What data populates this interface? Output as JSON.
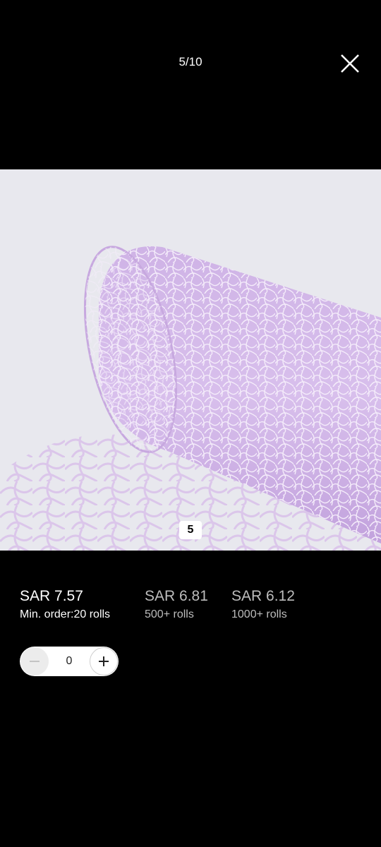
{
  "viewer": {
    "counter": "5/10",
    "close_icon": "close-icon",
    "image_badge": "5"
  },
  "product_image": {
    "description_icon": "product-photo",
    "colors": {
      "background": "#e9e9ef",
      "mesh": "#d5b8ea",
      "mesh_dark": "#b896d6"
    }
  },
  "pricing": {
    "tiers": [
      {
        "price": "SAR 7.57",
        "quantity": "Min. order:20 rolls"
      },
      {
        "price": "SAR 6.81",
        "quantity": "500+ rolls"
      },
      {
        "price": "SAR 6.12",
        "quantity": "1000+ rolls"
      }
    ]
  },
  "quantity_stepper": {
    "value": "0",
    "minus_icon": "minus-icon",
    "plus_icon": "plus-icon"
  }
}
